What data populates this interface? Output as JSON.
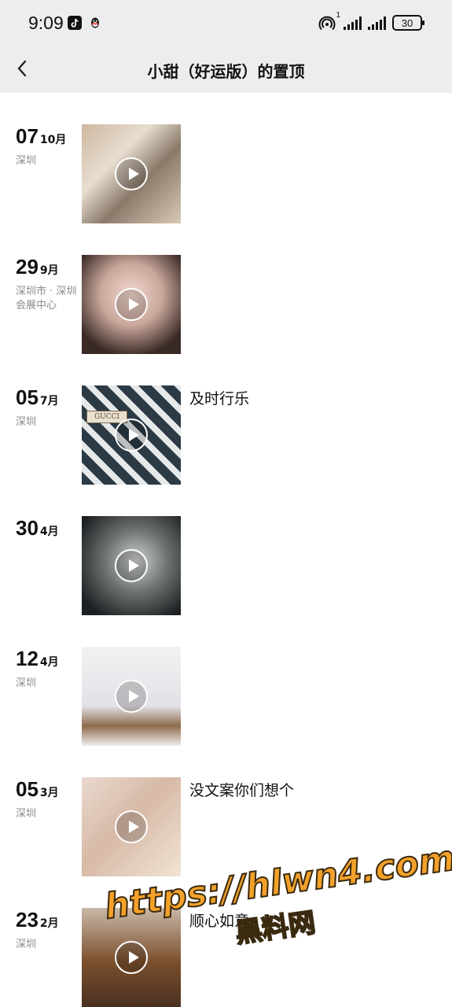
{
  "status_bar": {
    "time": "9:09",
    "battery": "30",
    "hotspot_sup": "1"
  },
  "header": {
    "title": "小甜（好运版）的置顶"
  },
  "posts": [
    {
      "day": "07",
      "month": "10月",
      "location": "深圳",
      "caption": ""
    },
    {
      "day": "29",
      "month": "9月",
      "location": "深圳市 · 深圳会展中心",
      "caption": ""
    },
    {
      "day": "05",
      "month": "7月",
      "location": "深圳",
      "caption": "及时行乐",
      "thumb_text": "GUCCI"
    },
    {
      "day": "30",
      "month": "4月",
      "location": "",
      "caption": ""
    },
    {
      "day": "12",
      "month": "4月",
      "location": "深圳",
      "caption": ""
    },
    {
      "day": "05",
      "month": "3月",
      "location": "深圳",
      "caption": "没文案你们想个"
    },
    {
      "day": "23",
      "month": "2月",
      "location": "深圳",
      "caption": "顺心如意"
    }
  ],
  "watermark": {
    "url": "https://hlwn4.com",
    "name": "黑料网"
  },
  "colors": {
    "topbar_bg": "#ededed",
    "location_gray": "#8a8a8a",
    "watermark_orange": "#f4a12a"
  }
}
